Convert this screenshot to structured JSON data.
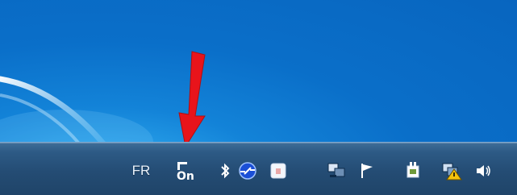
{
  "tray": {
    "language_indicator": "FR",
    "icons": [
      {
        "name": "on-app-tray-icon",
        "label": "On"
      },
      {
        "name": "bluetooth-icon"
      },
      {
        "name": "network-connection-icon"
      },
      {
        "name": "application-tray-icon"
      },
      {
        "name": "network-monitor-icon"
      },
      {
        "name": "action-center-flag-icon"
      },
      {
        "name": "power-plug-icon"
      },
      {
        "name": "network-warning-icon"
      },
      {
        "name": "volume-icon"
      }
    ]
  },
  "annotation": {
    "arrow_color": "#e8141b"
  }
}
